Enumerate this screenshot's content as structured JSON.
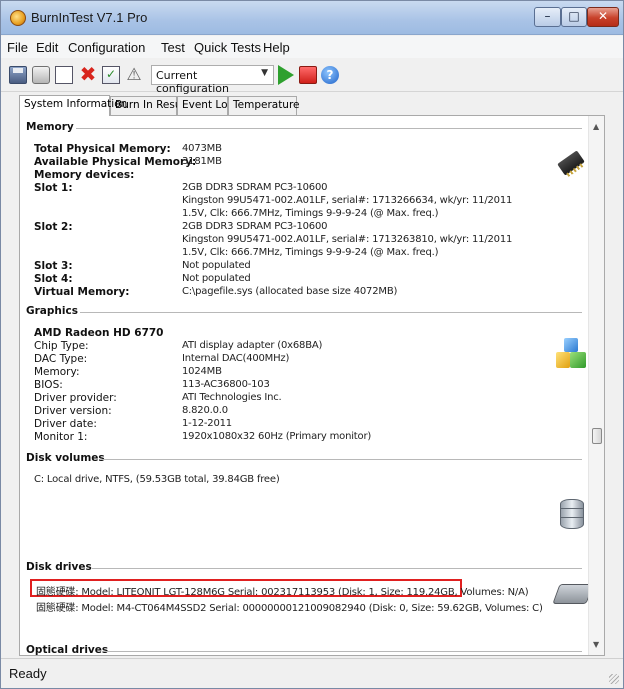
{
  "window": {
    "title": "BurnInTest V7.1 Pro",
    "min_icon": "minimize-icon",
    "max_icon": "maximize-icon",
    "close_icon": "close-icon"
  },
  "menu": [
    "File",
    "Edit",
    "Configuration",
    "Test",
    "Quick Tests",
    "Help"
  ],
  "toolbar": {
    "config_dropdown": "Current configuration"
  },
  "tabs": [
    "System Information",
    "Burn In Results",
    "Event Log",
    "Temperature"
  ],
  "memory": {
    "header": "Memory",
    "rows": [
      {
        "label": "Total Physical Memory:",
        "value": "4073MB"
      },
      {
        "label": "Available Physical Memory:",
        "value": "3181MB"
      },
      {
        "label": "Memory devices:",
        "value": ""
      },
      {
        "label": "Slot 1:",
        "value": "2GB DDR3 SDRAM PC3-10600"
      },
      {
        "label": "",
        "value": "Kingston 99U5471-002.A01LF, serial#: 1713266634, wk/yr: 11/2011"
      },
      {
        "label": "",
        "value": "1.5V, Clk: 666.7MHz, Timings 9-9-9-24 (@ Max. freq.)"
      },
      {
        "label": "Slot 2:",
        "value": "2GB DDR3 SDRAM PC3-10600"
      },
      {
        "label": "",
        "value": "Kingston 99U5471-002.A01LF, serial#: 1713263810, wk/yr: 11/2011"
      },
      {
        "label": "",
        "value": "1.5V, Clk: 666.7MHz, Timings 9-9-9-24 (@ Max. freq.)"
      },
      {
        "label": "Slot 3:",
        "value": "Not populated"
      },
      {
        "label": "Slot 4:",
        "value": "Not populated"
      },
      {
        "label": "Virtual Memory:",
        "value": "C:\\pagefile.sys (allocated base size 4072MB)"
      }
    ]
  },
  "graphics": {
    "header": "Graphics",
    "card": "AMD Radeon HD 6770",
    "rows": [
      {
        "label": "Chip Type:",
        "value": "ATI display adapter (0x68BA)"
      },
      {
        "label": "DAC Type:",
        "value": "Internal DAC(400MHz)"
      },
      {
        "label": "Memory:",
        "value": "1024MB"
      },
      {
        "label": "BIOS:",
        "value": "113-AC36800-103"
      },
      {
        "label": "Driver provider:",
        "value": "ATI Technologies Inc."
      },
      {
        "label": "Driver version:",
        "value": "8.820.0.0"
      },
      {
        "label": "Driver date:",
        "value": "1-12-2011"
      },
      {
        "label": "Monitor 1:",
        "value": "1920x1080x32 60Hz (Primary monitor)"
      }
    ]
  },
  "disk_volumes": {
    "header": "Disk volumes",
    "line": "C:  Local drive, NTFS, (59.53GB total, 39.84GB free)"
  },
  "disk_drives": {
    "header": "Disk drives",
    "lines": [
      "固態硬碟: Model: LITEONIT LGT-128M6G Serial: 002317113953 (Disk: 1, Size: 119.24GB, Volumes: N/A)",
      "固態硬碟: Model: M4-CT064M4SSD2 Serial: 0000000012100908294​0 (Disk: 0, Size: 59.62GB, Volumes: C)"
    ]
  },
  "optical_drives": {
    "header": "Optical drives"
  },
  "status": "Ready"
}
